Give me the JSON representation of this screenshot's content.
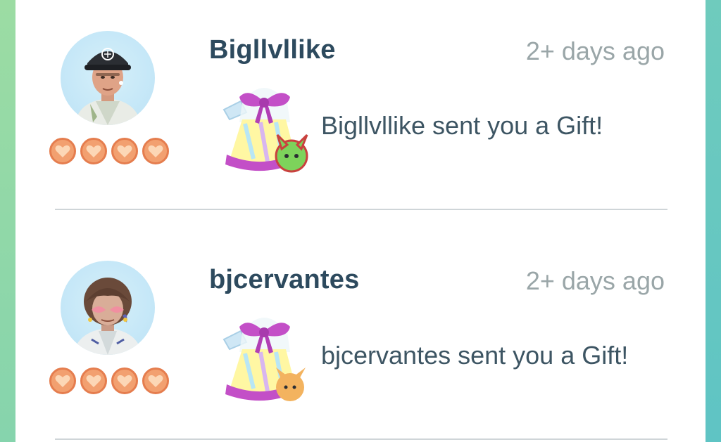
{
  "gift_list": [
    {
      "name": "Bigllvllike",
      "time": "2+ days ago",
      "message": "Bigllvllike sent you a Gift!",
      "friendship_hearts": 4,
      "sticker": "green-pikachu-ears-icon",
      "sticker_color": "#7dd35b"
    },
    {
      "name": "bjcervantes",
      "time": "2+ days ago",
      "message": "bjcervantes sent you a Gift!",
      "friendship_hearts": 4,
      "sticker": "orange-pikachu-ears-icon",
      "sticker_color": "#f3b35f"
    }
  ],
  "colors": {
    "name": "#2d4a5e",
    "time": "#9aa6a8",
    "message": "#3d5563",
    "heart_fill": "#f2a070",
    "heart_border": "#e57d4e",
    "gift_ribbon": "#c34fc7"
  }
}
